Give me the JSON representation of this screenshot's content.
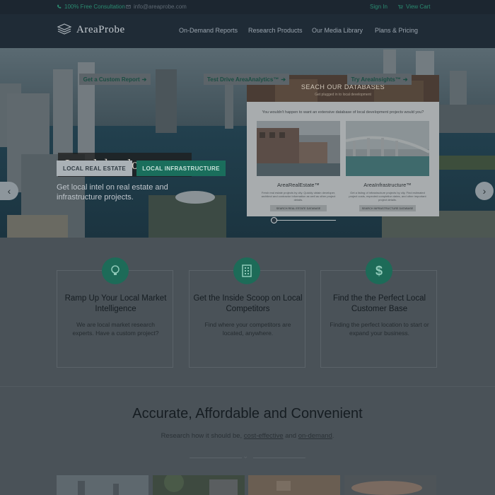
{
  "topbar": {
    "consultation": "100% Free Consultation",
    "email": "info@areaprobe.com",
    "sign_in": "Sign In",
    "view_cart": "View Cart"
  },
  "brand": {
    "name": "AreaProbe"
  },
  "nav": {
    "links": [
      "On-Demand Reports",
      "Research Products",
      "Our Media Library",
      "Plans & Pricing"
    ]
  },
  "hero": {
    "title": "Local development...",
    "subtitle": "Get local intel on real estate and infrastructure projects.",
    "btn_real_estate": "LOCAL REAL ESTATE",
    "btn_infrastructure": "LOCAL INFRASTRUCTURE",
    "prev_arrow": "‹",
    "next_arrow": "›"
  },
  "panel": {
    "title": "SEACH OUR DATABASES",
    "subtitle": "Get plugged in to local development",
    "question": "You wouldn't happen to want an extensive database of local development projects would you?",
    "products": [
      {
        "name": "AreaRealEstate™",
        "desc": "Fresh real estate projects by city. Quickly obtain developer, architect and contractor information as well as other project details.",
        "button": "SEARCH REAL ESTATE DATABASE"
      },
      {
        "name": "AreaInfrastructure™",
        "desc": "Get a listing of infrastructure projects by city. Find estimated project costs, expected completion dates, and other important project details.",
        "button": "SEARCH INFRASTRUCTURE DATABASE"
      }
    ]
  },
  "features": [
    {
      "title": "Ramp Up Your Local Market Intelligence",
      "text": "We are local market research experts. Have a custom project?",
      "button": "Get a Custom Report",
      "icon": "lightbulb-icon"
    },
    {
      "title": "Get the Inside Scoop on Local Competitors",
      "text": "Find where your competitors are located, anywhere.",
      "button": "Test Drive AreaAnalytics™",
      "icon": "building-icon"
    },
    {
      "title": "Find the the Perfect Local Customer Base",
      "text": "Finding the perfect location to start or expand your business.",
      "button": "Try AreaInsights™",
      "icon": "dollar-icon"
    }
  ],
  "section": {
    "headline": "Accurate, Affordable and Convenient",
    "tagline_pre": "Research how it should be, ",
    "tagline_link1": "cost-effective",
    "tagline_mid": " and ",
    "tagline_link2": "on-demand",
    "tagline_post": "."
  },
  "colors": {
    "accent_teal": "#1d6b58",
    "topbar_bg": "#1c2630",
    "nav_bg": "#1f2b36",
    "link_teal": "#1f8a70"
  }
}
